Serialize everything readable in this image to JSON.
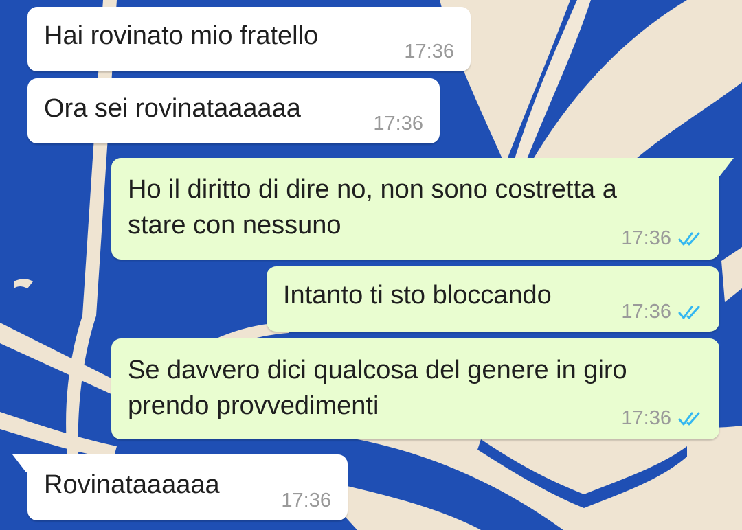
{
  "chat": {
    "accent": "#34b7f1",
    "incoming_bg": "#ffffff",
    "outgoing_bg": "#e9fdd0",
    "messages": [
      {
        "direction": "in",
        "text": "Hai rovinato mio fratello",
        "time": "17:36"
      },
      {
        "direction": "in",
        "text": "Ora sei rovinataaaaaa",
        "time": "17:36"
      },
      {
        "direction": "out",
        "text": "Ho il diritto di dire no, non sono costretta a\nstare con nessuno",
        "time": "17:36",
        "status": "read"
      },
      {
        "direction": "out",
        "text": "Intanto ti sto bloccando",
        "time": "17:36",
        "status": "read"
      },
      {
        "direction": "out",
        "text": "Se davvero dici qualcosa del genere in giro\nprendo provvedimenti",
        "time": "17:36",
        "status": "read"
      },
      {
        "direction": "in",
        "text": "Rovinataaaaaa",
        "time": "17:36"
      }
    ]
  },
  "icons": {
    "read_receipt": "double-check-icon"
  }
}
